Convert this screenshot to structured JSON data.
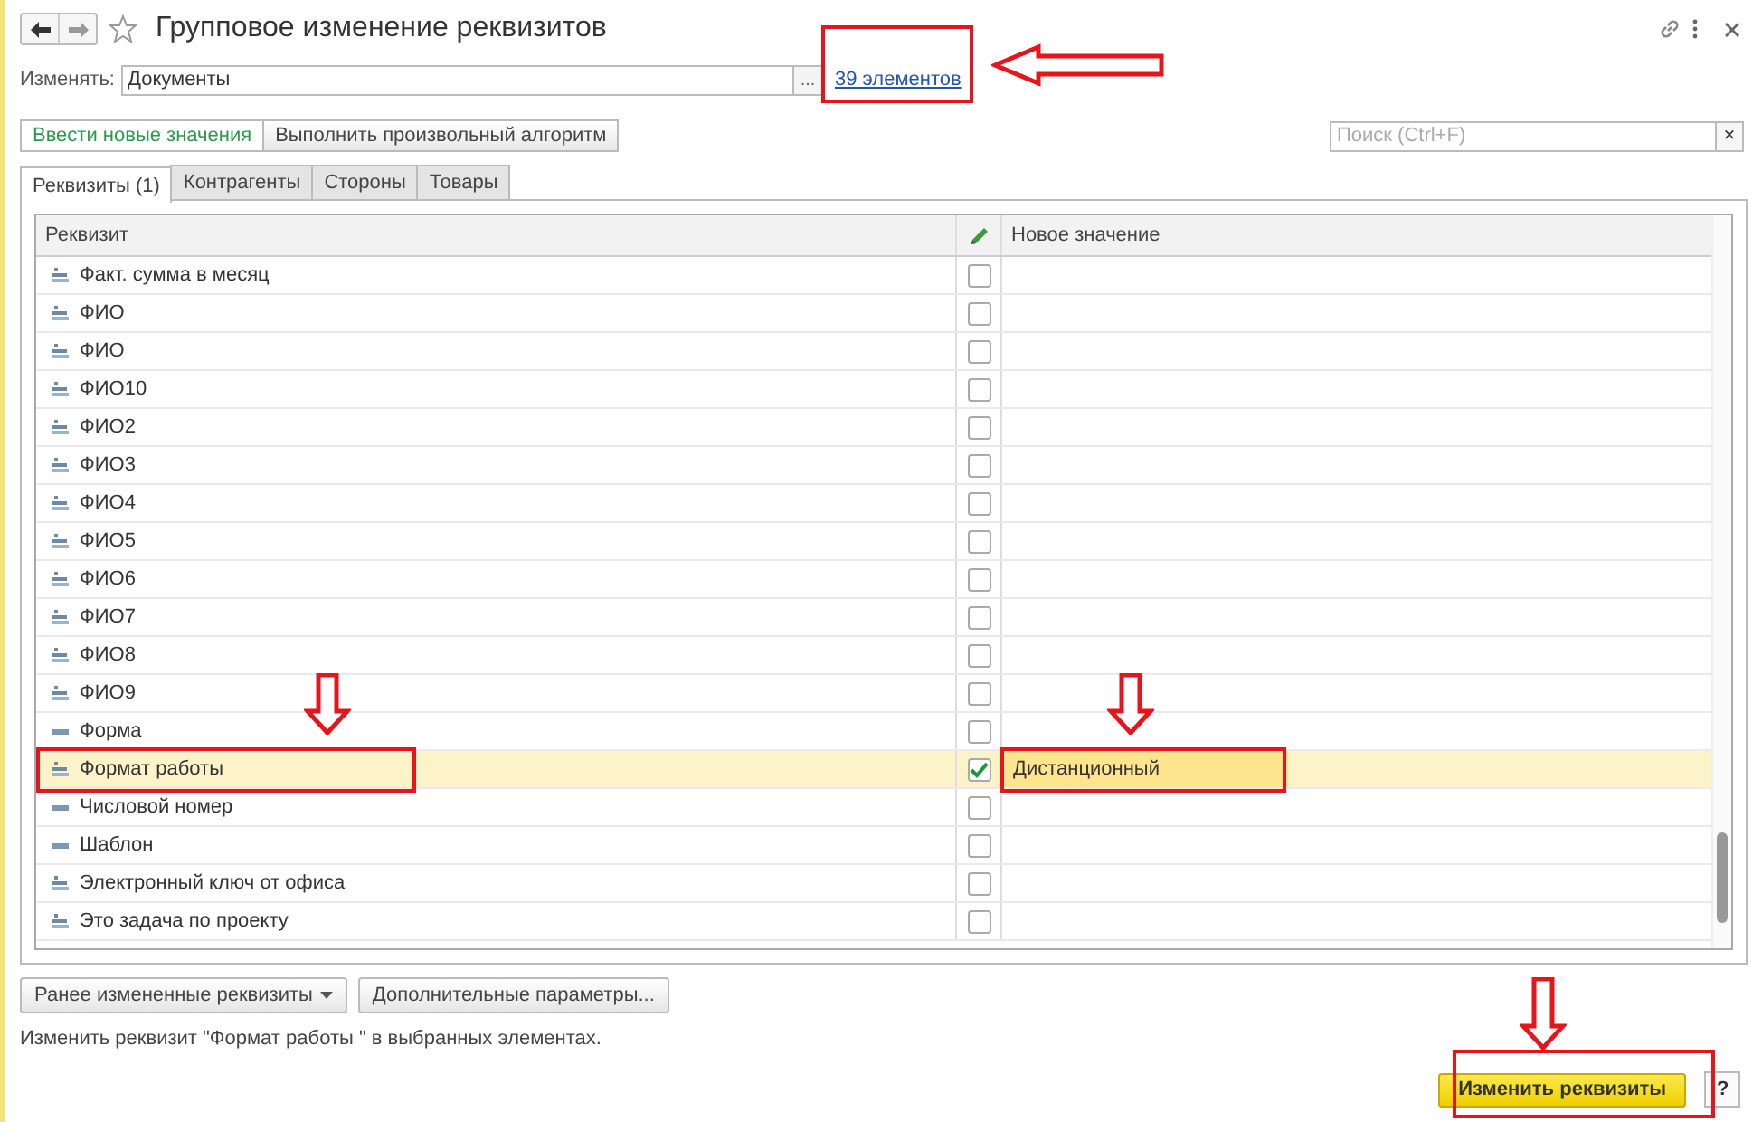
{
  "window": {
    "title": "Групповое изменение реквизитов"
  },
  "target": {
    "label": "Изменять:",
    "value": "Документы",
    "choose_button": "...",
    "link": "39 элементов"
  },
  "mode_buttons": [
    {
      "label": "Ввести новые значения",
      "selected": true
    },
    {
      "label": "Выполнить произвольный алгоритм",
      "selected": false
    }
  ],
  "search": {
    "placeholder": "Поиск (Ctrl+F)",
    "clear": "×"
  },
  "tabs": [
    {
      "label": "Реквизиты (1)",
      "selected": true
    },
    {
      "label": "Контрагенты",
      "selected": false
    },
    {
      "label": "Стороны",
      "selected": false
    },
    {
      "label": "Товары",
      "selected": false
    }
  ],
  "table": {
    "columns": [
      "Реквизит",
      "Новое значение"
    ],
    "rows": [
      {
        "name": "Факт. сумма в месяц",
        "kind": "stack",
        "checked": false,
        "selected": false
      },
      {
        "name": "ФИО",
        "kind": "stack",
        "checked": false,
        "selected": false
      },
      {
        "name": "ФИО",
        "kind": "stack",
        "checked": false,
        "selected": false
      },
      {
        "name": "ФИО10",
        "kind": "stack",
        "checked": false,
        "selected": false
      },
      {
        "name": "ФИО2",
        "kind": "stack",
        "checked": false,
        "selected": false
      },
      {
        "name": "ФИО3",
        "kind": "stack",
        "checked": false,
        "selected": false
      },
      {
        "name": "ФИО4",
        "kind": "stack",
        "checked": false,
        "selected": false
      },
      {
        "name": "ФИО5",
        "kind": "stack",
        "checked": false,
        "selected": false
      },
      {
        "name": "ФИО6",
        "kind": "stack",
        "checked": false,
        "selected": false
      },
      {
        "name": "ФИО7",
        "kind": "stack",
        "checked": false,
        "selected": false
      },
      {
        "name": "ФИО8",
        "kind": "stack",
        "checked": false,
        "selected": false
      },
      {
        "name": "ФИО9",
        "kind": "stack",
        "checked": false,
        "selected": false
      },
      {
        "name": "Форма",
        "kind": "line",
        "checked": false,
        "selected": false
      },
      {
        "name": "Формат работы",
        "kind": "stack",
        "checked": true,
        "selected": true,
        "value": "Дистанционный"
      },
      {
        "name": "Числовой номер",
        "kind": "line",
        "checked": false,
        "selected": false
      },
      {
        "name": "Шаблон",
        "kind": "line",
        "checked": false,
        "selected": false
      },
      {
        "name": "Электронный ключ от офиса",
        "kind": "stack",
        "checked": false,
        "selected": false
      },
      {
        "name": "Это задача по проекту",
        "kind": "stack",
        "checked": false,
        "selected": false
      }
    ]
  },
  "bottom_buttons": [
    {
      "label": "Ранее измененные реквизиты",
      "dropdown": true
    },
    {
      "label": "Дополнительные параметры...",
      "dropdown": false
    }
  ],
  "hint": "Изменить реквизит \"Формат работы \" в выбранных элементах.",
  "apply_button": "Изменить реквизиты",
  "help_button": "?"
}
